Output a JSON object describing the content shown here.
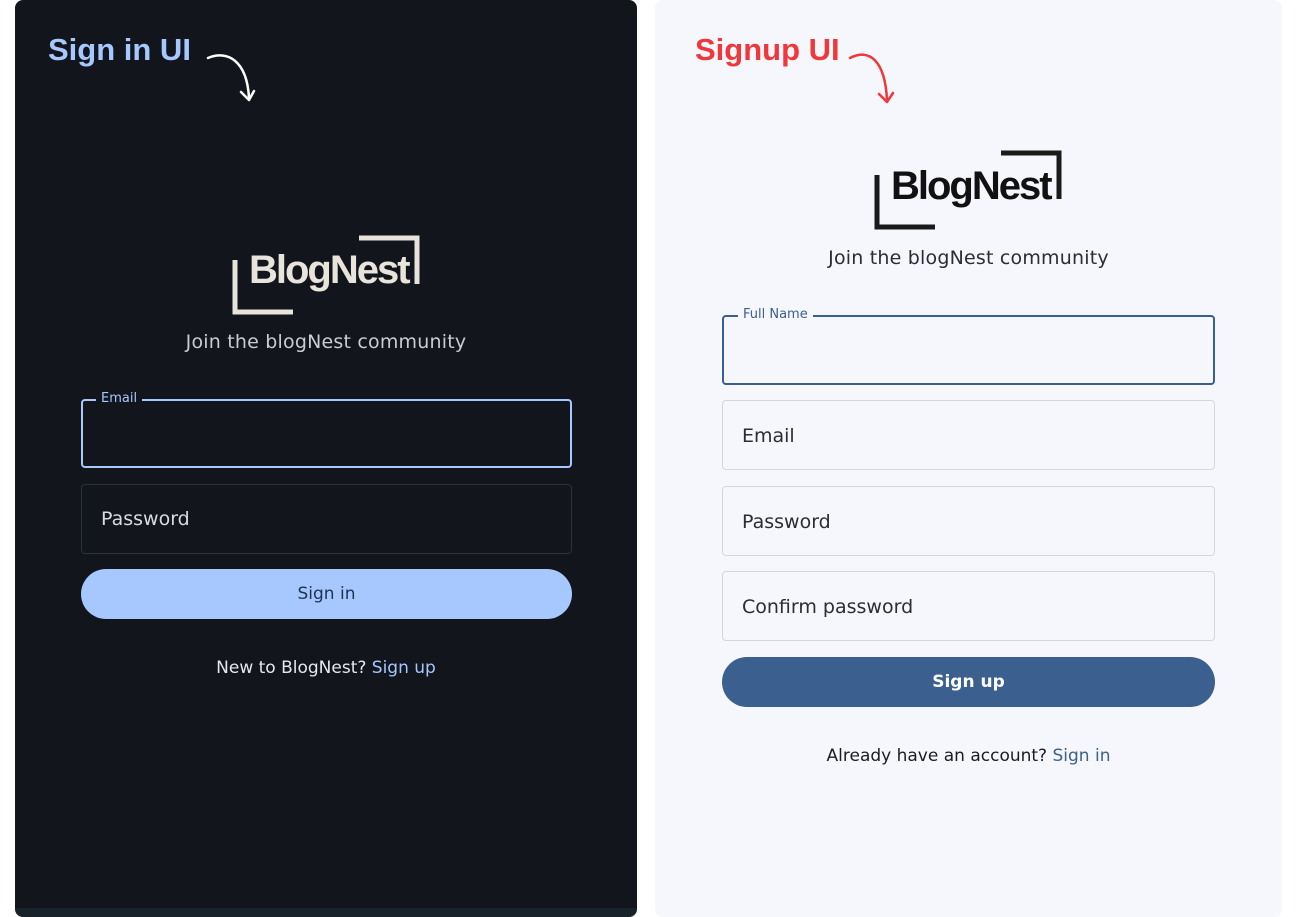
{
  "signin": {
    "caption": "Sign in UI",
    "logo_text": "BlogNest",
    "tagline": "Join the blogNest community",
    "email_label": "Email",
    "password_placeholder": "Password",
    "submit_label": "Sign in",
    "footer_text": "New to BlogNest? ",
    "footer_link": "Sign up",
    "colors": {
      "background": "#12151b",
      "accent": "#a6c8ff",
      "text": "#e6e8ee",
      "muted": "#c8ccd4",
      "button_text": "#1e3251"
    }
  },
  "signup": {
    "caption": "Signup UI",
    "logo_text": "BlogNest",
    "tagline": "Join the blogNest community",
    "fullname_label": "Full Name",
    "email_placeholder": "Email",
    "password_placeholder": "Password",
    "confirm_placeholder": "Confirm password",
    "submit_label": "Sign up",
    "footer_text": "Already have an account? ",
    "footer_link": "Sign in",
    "colors": {
      "background": "#f6f7fc",
      "accent": "#3b5f8f",
      "caption": "#f0373b",
      "text": "#1a1c20",
      "button_text": "#ffffff"
    }
  },
  "icons": {
    "caption_arrow": "curved-arrow-icon",
    "logo_bracket": "bracket-frame-icon"
  }
}
